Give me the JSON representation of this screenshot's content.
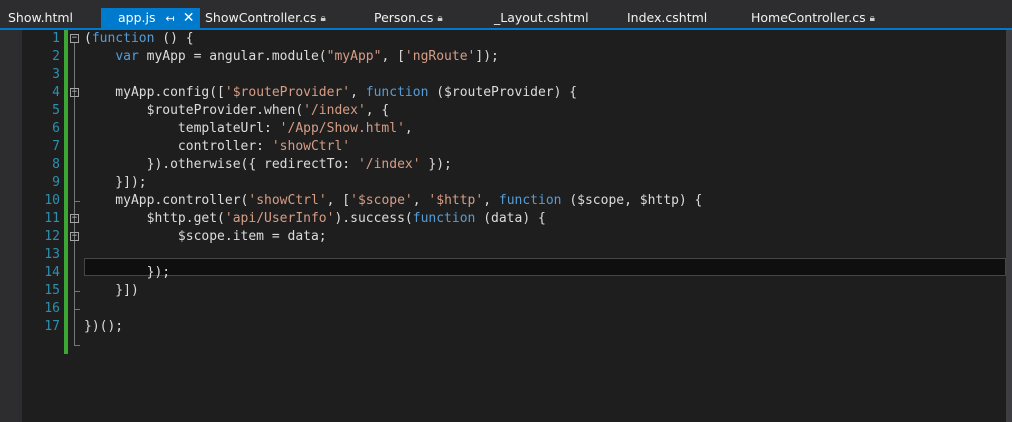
{
  "tabs": [
    {
      "label": "Show.html",
      "locked": false,
      "active": false
    },
    {
      "label": "app.js",
      "locked": false,
      "active": true
    },
    {
      "label": "ShowController.cs",
      "locked": true,
      "active": false
    },
    {
      "label": "Person.cs",
      "locked": true,
      "active": false
    },
    {
      "label": "_Layout.cshtml",
      "locked": false,
      "active": false
    },
    {
      "label": "Index.cshtml",
      "locked": false,
      "active": false
    },
    {
      "label": "HomeController.cs",
      "locked": true,
      "active": false
    }
  ],
  "icons": {
    "pin": "pin-icon",
    "close": "close-icon",
    "lock": "lock-icon",
    "fold": "fold-icon"
  },
  "colors": {
    "keyword": "#569cd6",
    "string": "#d69d85",
    "text": "#dcdcdc",
    "line_number": "#2b91af",
    "change_bar": "#3aa832",
    "accent": "#007acc"
  },
  "editor": {
    "current_line": 13,
    "lines": [
      {
        "num": "1",
        "tokens": [
          [
            "txt",
            "("
          ],
          [
            "kw",
            "function"
          ],
          [
            "txt",
            " () {"
          ]
        ]
      },
      {
        "num": "2",
        "tokens": [
          [
            "txt",
            "    "
          ],
          [
            "kw",
            "var"
          ],
          [
            "txt",
            " myApp = angular.module("
          ],
          [
            "str",
            "\"myApp\""
          ],
          [
            "txt",
            ", ["
          ],
          [
            "str",
            "'ngRoute'"
          ],
          [
            "txt",
            "]);"
          ]
        ]
      },
      {
        "num": "3",
        "tokens": []
      },
      {
        "num": "4",
        "tokens": [
          [
            "txt",
            "    myApp.config(["
          ],
          [
            "str",
            "'$routeProvider'"
          ],
          [
            "txt",
            ", "
          ],
          [
            "kw",
            "function"
          ],
          [
            "txt",
            " ($routeProvider) {"
          ]
        ]
      },
      {
        "num": "5",
        "tokens": [
          [
            "txt",
            "        $routeProvider.when("
          ],
          [
            "str",
            "'/index'"
          ],
          [
            "txt",
            ", {"
          ]
        ]
      },
      {
        "num": "6",
        "tokens": [
          [
            "txt",
            "            templateUrl: "
          ],
          [
            "str",
            "'/App/Show.html'"
          ],
          [
            "txt",
            ","
          ]
        ]
      },
      {
        "num": "7",
        "tokens": [
          [
            "txt",
            "            controller: "
          ],
          [
            "str",
            "'showCtrl'"
          ]
        ]
      },
      {
        "num": "8",
        "tokens": [
          [
            "txt",
            "        }).otherwise({ redirectTo: "
          ],
          [
            "str",
            "'/index'"
          ],
          [
            "txt",
            " });"
          ]
        ]
      },
      {
        "num": "9",
        "tokens": [
          [
            "txt",
            "    }]);"
          ]
        ]
      },
      {
        "num": "10",
        "tokens": [
          [
            "txt",
            "    myApp.controller("
          ],
          [
            "str",
            "'showCtrl'"
          ],
          [
            "txt",
            ", ["
          ],
          [
            "str",
            "'$scope'"
          ],
          [
            "txt",
            ", "
          ],
          [
            "str",
            "'$http'"
          ],
          [
            "txt",
            ", "
          ],
          [
            "kw",
            "function"
          ],
          [
            "txt",
            " ($scope, $http) {"
          ]
        ]
      },
      {
        "num": "11",
        "tokens": [
          [
            "txt",
            "        $http.get("
          ],
          [
            "str",
            "'api/UserInfo'"
          ],
          [
            "txt",
            ").success("
          ],
          [
            "kw",
            "function"
          ],
          [
            "txt",
            " (data) {"
          ]
        ]
      },
      {
        "num": "12",
        "tokens": [
          [
            "txt",
            "            $scope.item = data;"
          ]
        ]
      },
      {
        "num": "13",
        "tokens": []
      },
      {
        "num": "14",
        "tokens": [
          [
            "txt",
            "        });"
          ]
        ]
      },
      {
        "num": "15",
        "tokens": [
          [
            "txt",
            "    }])"
          ]
        ]
      },
      {
        "num": "16",
        "tokens": []
      },
      {
        "num": "17",
        "tokens": [
          [
            "txt",
            "})();"
          ]
        ]
      }
    ]
  }
}
